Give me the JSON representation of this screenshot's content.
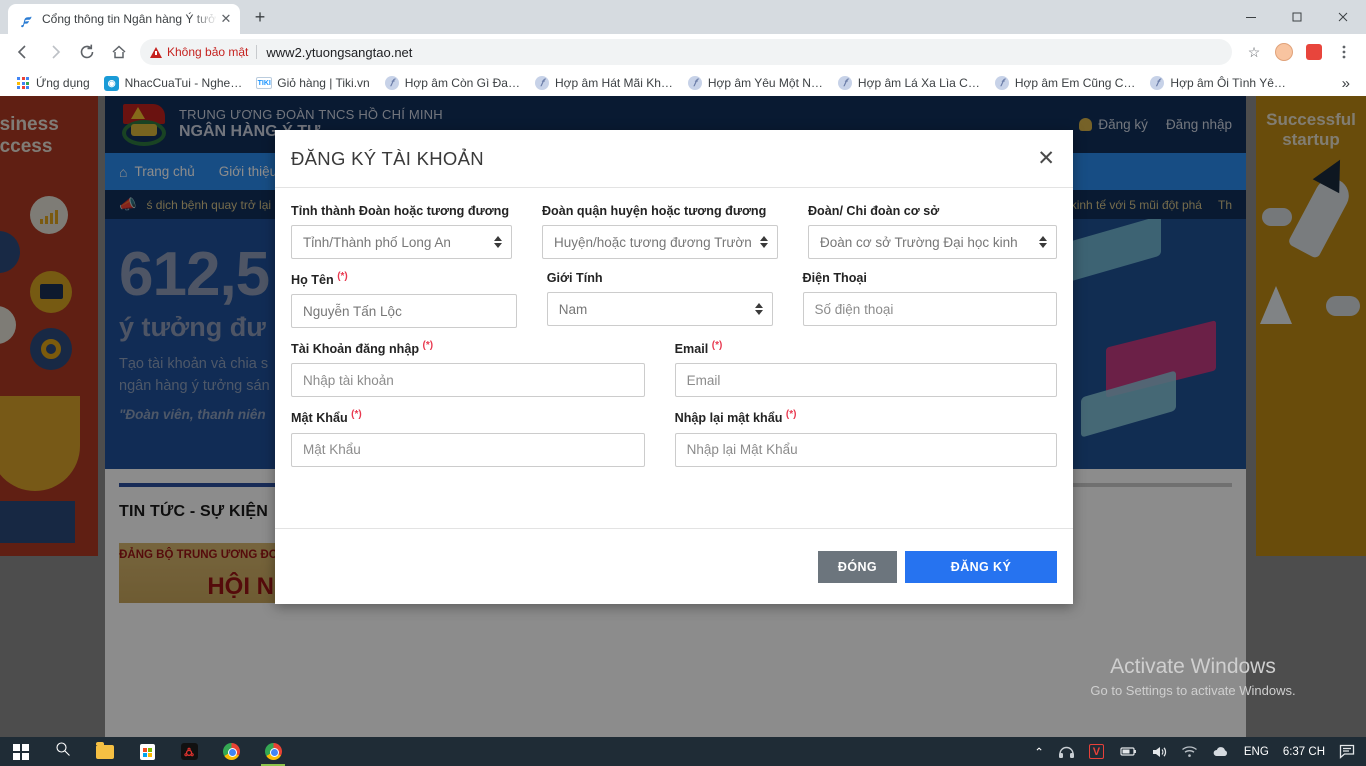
{
  "browser": {
    "tab": {
      "title": "Cổng thông tin Ngân hàng Ý tưở",
      "close": "✕",
      "favicon": "ytuongsangtao-favicon"
    },
    "new_tab": "+",
    "window_controls": {
      "minimize": "—",
      "maximize": "▫",
      "close": "✕"
    },
    "nav": {
      "back": "←",
      "forward": "→",
      "reload": "⟳",
      "home": "⌂"
    },
    "omnibox": {
      "security_label": "Không bảo mật",
      "url": "www2.ytuongsangtao.net",
      "star": "☆"
    },
    "toolbar_icons": [
      "star-icon",
      "profile-avatar",
      "extension-icon",
      "chrome-menu-icon"
    ],
    "bookmarks": [
      {
        "label": "Ứng dụng",
        "icon": "apps-grid-icon"
      },
      {
        "label": "NhacCuaTui - Nghe…",
        "icon": "nhaccuatui-icon"
      },
      {
        "label": "Giỏ hàng | Tiki.vn",
        "icon": "tiki-icon"
      },
      {
        "label": "Hợp âm Còn Gì Đa…",
        "icon": "hopam-icon"
      },
      {
        "label": "Hợp âm Hát Mãi Kh…",
        "icon": "hopam-icon"
      },
      {
        "label": "Hợp âm Yêu Một N…",
        "icon": "hopam-icon"
      },
      {
        "label": "Hợp âm Lá Xa Lìa C…",
        "icon": "hopam-icon"
      },
      {
        "label": "Hợp âm Em Cũng C…",
        "icon": "hopam-icon"
      },
      {
        "label": "Hợp âm Ôi Tình Yê…",
        "icon": "hopam-icon"
      }
    ],
    "bookmarks_overflow": "»"
  },
  "ads": {
    "left": {
      "line1": "usiness",
      "line2": "uccess"
    },
    "right": {
      "line1": "Successful",
      "line2": "startup"
    }
  },
  "site": {
    "brand_line1": "TRUNG ƯƠNG ĐOÀN TNCS HỒ CHÍ MINH",
    "brand_line2": "NGÂN HÀNG Ý TƯ",
    "header_links": [
      {
        "label": "Đăng ký",
        "icon": "user-icon"
      },
      {
        "label": "Đăng nhập"
      }
    ],
    "nav": [
      {
        "label": "Trang chủ",
        "icon": "home-icon"
      },
      {
        "label": "Giới thiệu"
      }
    ],
    "ticker": {
      "icon": "megaphone-icon",
      "text": "ś dịch bệnh quay trở lại",
      "text_right": "kinh tế với 5 mũi đột phá",
      "text_right2": "Th"
    },
    "hero": {
      "big_number": "612,5",
      "subtitle": "ý tưởng đư",
      "paragraph_line1": "Tạo tài khoản và chia s",
      "paragraph_line2": "ngân hàng ý tưởng sán",
      "quote": "\"Đoàn viên, thanh niên"
    },
    "news": {
      "section_title": "TIN TỨC - SỰ KIỆN",
      "cards": [
        {
          "headline": "ĐẢNG BỘ TRUNG ƯƠNG ĐOÀN TNCS HỒ CHÍ MINH",
          "subhead": "HỘI NGHỊ"
        },
        {
          "headline": ""
        },
        {
          "headline": ""
        }
      ]
    }
  },
  "modal": {
    "title": "ĐĂNG KÝ TÀI KHOẢN",
    "close_icon": "✕",
    "required_mark": "(*)",
    "fields": {
      "province": {
        "label": "Tỉnh thành Đoàn hoặc tương đương",
        "value": "Tỉnh/Thành phố Long An",
        "type": "select"
      },
      "district": {
        "label": "Đoàn quận huyện hoặc tương đương",
        "value": "Huyện/hoặc tương đương Trườn",
        "type": "select"
      },
      "branch": {
        "label": "Đoàn/ Chi đoàn cơ sở",
        "value": "Đoàn cơ sở Trường Đại học kinh",
        "type": "select"
      },
      "fullname": {
        "label": "Họ Tên",
        "required": true,
        "value": "Nguyễn Tấn Lộc",
        "type": "text"
      },
      "gender": {
        "label": "Giới Tính",
        "value": "Nam",
        "type": "select"
      },
      "phone": {
        "label": "Điện Thoại",
        "placeholder": "Số điện thoại",
        "value": "",
        "type": "text"
      },
      "username": {
        "label": "Tài Khoản đăng nhập",
        "required": true,
        "placeholder": "Nhập tài khoản",
        "value": "",
        "type": "text"
      },
      "email": {
        "label": "Email",
        "required": true,
        "placeholder": "Email",
        "value": "",
        "type": "text"
      },
      "password": {
        "label": "Mật Khẩu",
        "required": true,
        "placeholder": "Mật Khẩu",
        "value": "",
        "type": "password"
      },
      "password_confirm": {
        "label": "Nhập lại mật khẩu",
        "required": true,
        "placeholder": "Nhập lại Mật Khẩu",
        "value": "",
        "type": "password"
      }
    },
    "buttons": {
      "close": "ĐÓNG",
      "submit": "ĐĂNG KÝ"
    },
    "colors": {
      "submit": "#2673f0",
      "close": "#6c757d",
      "required": "#e8384f"
    }
  },
  "watermark": {
    "line1": "Activate Windows",
    "line2": "Go to Settings to activate Windows."
  },
  "taskbar": {
    "start": "windows-logo",
    "items": [
      {
        "icon": "search-icon"
      },
      {
        "icon": "file-explorer-icon"
      },
      {
        "icon": "microsoft-store-icon"
      },
      {
        "icon": "garena-icon"
      },
      {
        "icon": "chrome-icon"
      },
      {
        "icon": "chrome-icon-active"
      }
    ],
    "tray": {
      "chevron": "⌃",
      "icons": [
        "headphone-icon",
        "v-icon",
        "battery-icon",
        "volume-icon",
        "wifi-icon",
        "onedrive-icon"
      ],
      "language": "ENG",
      "time": "6:37 CH",
      "notification": "notification-icon"
    }
  }
}
